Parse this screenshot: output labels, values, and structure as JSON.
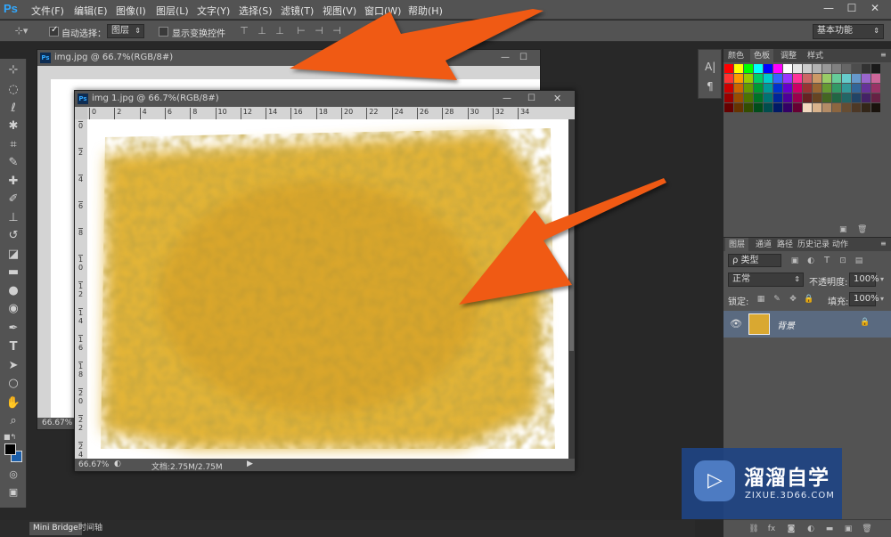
{
  "app": {
    "logo": "Ps"
  },
  "menus": [
    "文件(F)",
    "编辑(E)",
    "图像(I)",
    "图层(L)",
    "文字(Y)",
    "选择(S)",
    "滤镜(T)",
    "视图(V)",
    "窗口(W)",
    "帮助(H)"
  ],
  "window_controls": {
    "minimize": "—",
    "maximize": "☐",
    "close": "✕"
  },
  "options": {
    "auto_select_label": "自动选择：",
    "auto_select_checked": true,
    "auto_select_target": "图层",
    "show_transform_label": "显示变换控件",
    "show_transform_checked": false,
    "workspace": "基本功能"
  },
  "tools": [
    "move-tool-icon",
    "marquee-tool-icon",
    "lasso-tool-icon",
    "magic-wand-tool-icon",
    "crop-tool-icon",
    "eyedropper-tool-icon",
    "healing-brush-tool-icon",
    "brush-tool-icon",
    "clone-stamp-tool-icon",
    "history-brush-tool-icon",
    "eraser-tool-icon",
    "gradient-tool-icon",
    "blur-tool-icon",
    "dodge-tool-icon",
    "pen-tool-icon",
    "type-tool-icon",
    "path-selection-tool-icon",
    "ellipse-tool-icon",
    "hand-tool-icon",
    "zoom-tool-icon"
  ],
  "colors": {
    "foreground": "#000000",
    "background": "#1c5faa",
    "accent_arrow": "#f05a14"
  },
  "doc_back": {
    "title": "img.jpg @ 66.7%(RGB/8#)",
    "zoom": "66.67%"
  },
  "doc_front": {
    "title": "img 1.jpg @ 66.7%(RGB/8#)",
    "zoom": "66.67%",
    "doc_info": "文档:2.75M/2.75M",
    "ruler_h": [
      "0",
      "2",
      "4",
      "6",
      "8",
      "10",
      "12",
      "14",
      "16",
      "18",
      "20",
      "22",
      "24",
      "26",
      "28",
      "30",
      "32",
      "34"
    ],
    "ruler_v": [
      "0",
      "2",
      "4",
      "6",
      "8",
      "1\n0",
      "1\n2",
      "1\n4",
      "1\n6",
      "1\n8",
      "2\n0",
      "2\n2",
      "2\n4"
    ]
  },
  "swatches_panel": {
    "tabs": [
      "颜色",
      "色板",
      "调整",
      "样式"
    ],
    "active": "色板"
  },
  "swatch_colors": [
    [
      "#ff0000",
      "#ffff00",
      "#00ff00",
      "#00ffff",
      "#0000ff",
      "#ff00ff",
      "#ffffff",
      "#e6e6e6",
      "#cccccc",
      "#b3b3b3",
      "#999999",
      "#808080",
      "#666666",
      "#4d4d4d",
      "#333333",
      "#1a1a1a"
    ],
    [
      "#ff3333",
      "#ff9900",
      "#99cc00",
      "#00cc66",
      "#00cccc",
      "#3366ff",
      "#9933ff",
      "#ff3399",
      "#cc6666",
      "#cc9966",
      "#99cc66",
      "#66cc99",
      "#66cccc",
      "#6699cc",
      "#9966cc",
      "#cc6699"
    ],
    [
      "#cc0000",
      "#cc6600",
      "#669900",
      "#009933",
      "#009999",
      "#0033cc",
      "#6600cc",
      "#cc0066",
      "#993333",
      "#996633",
      "#669933",
      "#339966",
      "#339999",
      "#336699",
      "#663399",
      "#993366"
    ],
    [
      "#990000",
      "#994c00",
      "#4d7300",
      "#007326",
      "#007373",
      "#002699",
      "#4d0099",
      "#99004d",
      "#662222",
      "#664422",
      "#446622",
      "#226644",
      "#226666",
      "#224466",
      "#442266",
      "#662244"
    ],
    [
      "#660000",
      "#663300",
      "#334d00",
      "#004d1a",
      "#004d4d",
      "#001a66",
      "#330066",
      "#660033",
      "#f2d9c0",
      "#d9b38c",
      "#b38c66",
      "#8c6640",
      "#664d33",
      "#4d3826",
      "#332619",
      "#1a130d"
    ]
  ],
  "layers_panel": {
    "tabs": [
      "图层",
      "通道",
      "路径",
      "历史记录",
      "动作"
    ],
    "filter_label": "ρ 类型",
    "blend_mode": "正常",
    "opacity_label": "不透明度:",
    "opacity_value": "100%",
    "lock_label": "锁定:",
    "fill_label": "填充:",
    "fill_value": "100%",
    "layers": [
      {
        "name": "背景",
        "visible": true,
        "locked": true
      }
    ]
  },
  "bottom_tabs": [
    "Mini Bridge",
    "时间轴"
  ],
  "watermark": {
    "brand": "溜溜自学",
    "url": "ZIXUE.3D66.COM"
  }
}
